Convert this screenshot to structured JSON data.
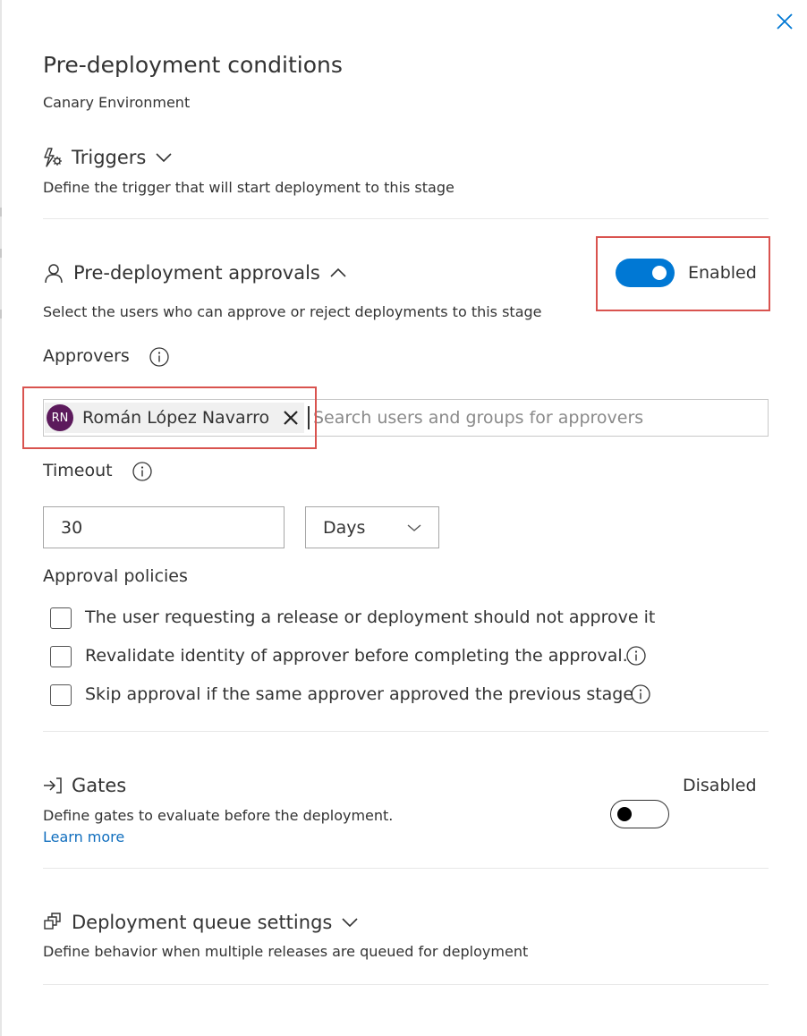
{
  "panel": {
    "title": "Pre-deployment conditions",
    "subtitle": "Canary Environment",
    "close_icon": "close-icon"
  },
  "triggers": {
    "label": "Triggers",
    "description": "Define the trigger that will start deployment to this stage",
    "icon": "lightning-gear-icon",
    "expanded": false
  },
  "approvals": {
    "label": "Pre-deployment approvals",
    "description": "Select the users who can approve or reject deployments to this stage",
    "icon": "person-icon",
    "expanded": true,
    "toggle_label": "Enabled",
    "enabled": true,
    "approvers_label": "Approvers",
    "approver": {
      "initials": "RN",
      "name": "Román López Navarro",
      "avatar_color": "#5c1a5c"
    },
    "search_placeholder": "Search users and groups for approvers",
    "timeout_label": "Timeout",
    "timeout_value": "30",
    "timeout_unit": "Days",
    "policies_label": "Approval policies",
    "policies": [
      {
        "label": "The user requesting a release or deployment should not approve it",
        "checked": false,
        "info": false
      },
      {
        "label": "Revalidate identity of approver before completing the approval.",
        "checked": false,
        "info": true
      },
      {
        "label": "Skip approval if the same approver approved the previous stage",
        "checked": false,
        "info": true
      }
    ]
  },
  "gates": {
    "label": "Gates",
    "description": "Define gates to evaluate before the deployment.",
    "learn_more": "Learn more",
    "icon": "gate-arrow-icon",
    "toggle_label": "Disabled",
    "enabled": false
  },
  "queue": {
    "label": "Deployment queue settings",
    "description": "Define behavior when multiple releases are queued for deployment",
    "icon": "queue-icon",
    "expanded": false
  },
  "colors": {
    "accent": "#0078d4",
    "highlight": "#d9534f",
    "link": "#106ebe"
  }
}
